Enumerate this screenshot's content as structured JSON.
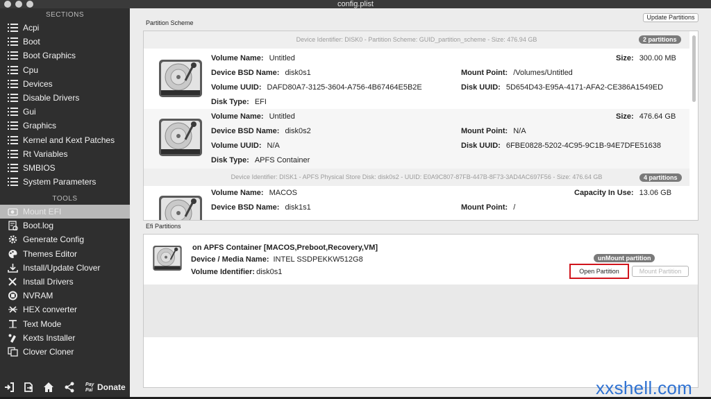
{
  "window": {
    "title": "config.plist"
  },
  "sidebar": {
    "sections_header": "SECTIONS",
    "sections": [
      "Acpi",
      "Boot",
      "Boot Graphics",
      "Cpu",
      "Devices",
      "Disable Drivers",
      "Gui",
      "Graphics",
      "Kernel and Kext Patches",
      "Rt Variables",
      "SMBIOS",
      "System Parameters"
    ],
    "tools_header": "TOOLS",
    "tools": [
      {
        "label": "Mount EFI",
        "icon": "hard-drive-icon",
        "selected": true
      },
      {
        "label": "Boot.log",
        "icon": "log-icon"
      },
      {
        "label": "Generate Config",
        "icon": "gear-icon"
      },
      {
        "label": "Themes Editor",
        "icon": "palette-icon"
      },
      {
        "label": "Install/Update Clover",
        "icon": "download-icon"
      },
      {
        "label": "Install Drivers",
        "icon": "tools-icon"
      },
      {
        "label": "NVRAM",
        "icon": "nvram-icon"
      },
      {
        "label": "HEX converter",
        "icon": "hex-icon"
      },
      {
        "label": "Text Mode",
        "icon": "text-icon"
      },
      {
        "label": "Kexts Installer",
        "icon": "kext-icon"
      },
      {
        "label": "Clover Cloner",
        "icon": "clone-icon"
      }
    ],
    "bottom": {
      "donate_label": "Donate",
      "paypal_line1": "Pay",
      "paypal_line2": "Pal"
    }
  },
  "partition_scheme": {
    "group_label": "Partition Scheme",
    "update_button": "Update Partitions",
    "disks": [
      {
        "header": "Device Identifier: DISK0 - Partition Scheme: GUID_partition_scheme - Size: 476.94 GB",
        "badge": "2 partitions",
        "partitions": [
          {
            "volume_name_label": "Volume Name:",
            "volume_name": "Untitled",
            "size_label": "Size:",
            "size": "300.00 MB",
            "bsd_label": "Device BSD Name:",
            "bsd": "disk0s1",
            "mount_label": "Mount Point:",
            "mount": "/Volumes/Untitled",
            "vuuid_label": "Volume UUID:",
            "vuuid": "DAFD80A7-3125-3604-A756-4B67464E5B2E",
            "duuid_label": "Disk UUID:",
            "duuid": "5D654D43-E95A-4171-AFA2-CE386A1549ED",
            "type_label": "Disk Type:",
            "type": "EFI"
          },
          {
            "volume_name_label": "Volume Name:",
            "volume_name": "Untitled",
            "size_label": "Size:",
            "size": "476.64 GB",
            "bsd_label": "Device BSD Name:",
            "bsd": "disk0s2",
            "mount_label": "Mount Point:",
            "mount": "N/A",
            "vuuid_label": "Volume UUID:",
            "vuuid": "N/A",
            "duuid_label": "Disk UUID:",
            "duuid": "6FBE0828-5202-4C95-9C1B-94E7DFE51638",
            "type_label": "Disk Type:",
            "type": "APFS Container"
          }
        ]
      },
      {
        "header": "Device Identifier: DISK1 - APFS Physical Store Disk: disk0s2 - UUID: E0A9C807-87FB-447B-8F73-3AD4AC697F56 - Size: 476.64 GB",
        "badge": "4 partitions",
        "partitions": [
          {
            "volume_name_label": "Volume Name:",
            "volume_name": "MACOS",
            "capacity_label": "Capacity In Use:",
            "capacity": "13.06 GB",
            "bsd_label": "Device BSD Name:",
            "bsd": "disk1s1",
            "mount_label": "Mount Point:",
            "mount": "/"
          }
        ]
      }
    ]
  },
  "efi": {
    "group_label": "Efi Partitions",
    "title": "on APFS Container [MACOS,Preboot,Recovery,VM]",
    "media_label": "Device / Media Name:",
    "media": "INTEL SSDPEKKW512G8",
    "volid_label": "Volume Identifier:",
    "volid": "disk0s1",
    "status_badge": "unMount partition",
    "open_button": "Open Partition",
    "mount_button": "Mount Partition",
    "highlight_color": "#d0141c"
  },
  "watermark": "xxshell.com"
}
